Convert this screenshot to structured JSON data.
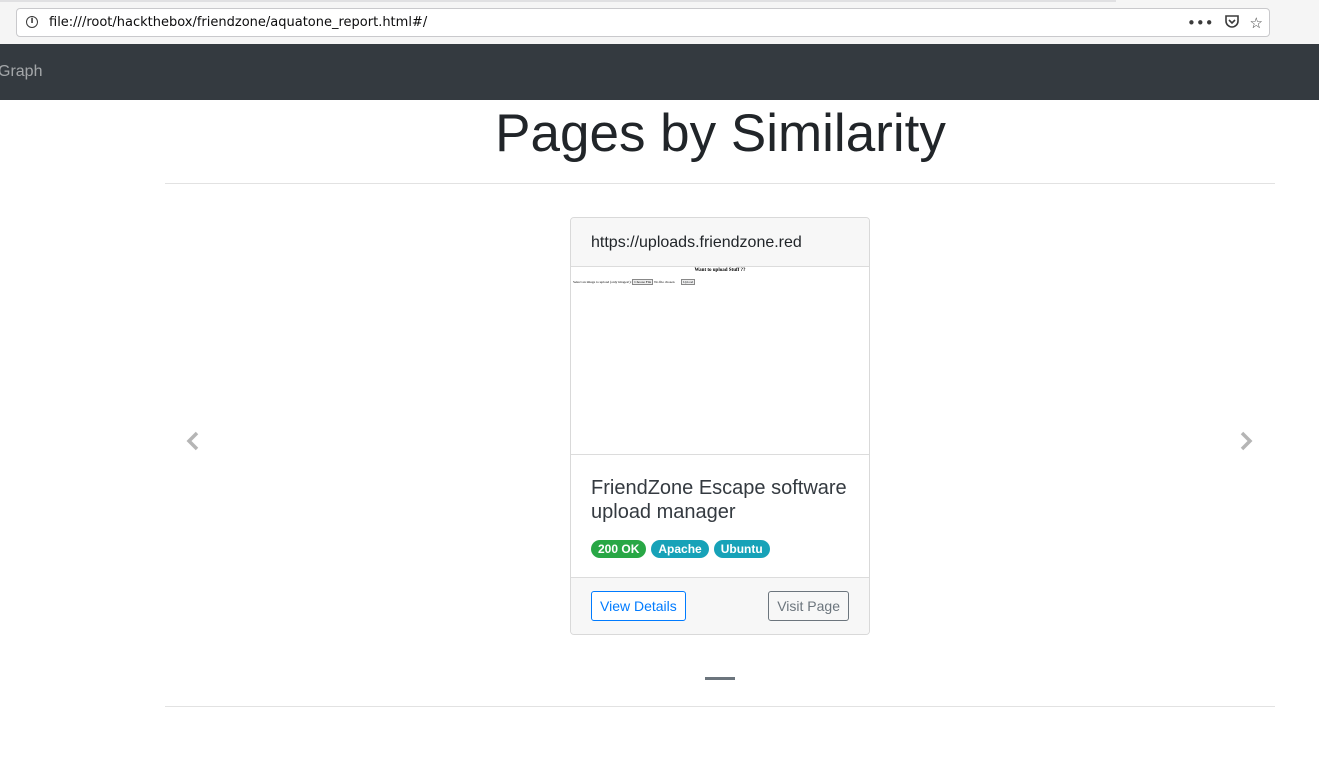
{
  "browser": {
    "url": "file:///root/hackthebox/friendzone/aquatone_report.html#/",
    "icons": [
      "info-icon",
      "more-icon",
      "pocket-icon",
      "bookmark-star-icon"
    ]
  },
  "navbar": {
    "link": "Graph"
  },
  "page": {
    "title": "Pages by Similarity"
  },
  "card": {
    "header": "https://uploads.friendzone.red",
    "screenshot": {
      "title": "Want to upload Stuff ??",
      "line": "Select an image to upload (only images!):",
      "choose_button": "Choose File",
      "no_file": "No file chosen",
      "upload_button": "Upload"
    },
    "title": "FriendZone Escape software upload manager",
    "badges": [
      {
        "label": "200 OK",
        "color": "#28a745"
      },
      {
        "label": "Apache",
        "color": "#17a2b8"
      },
      {
        "label": "Ubuntu",
        "color": "#17a2b8"
      }
    ],
    "buttons": {
      "details": "View Details",
      "visit": "Visit Page"
    }
  },
  "carousel": {
    "prev_icon": "chevron-left-icon",
    "next_icon": "chevron-right-icon"
  }
}
